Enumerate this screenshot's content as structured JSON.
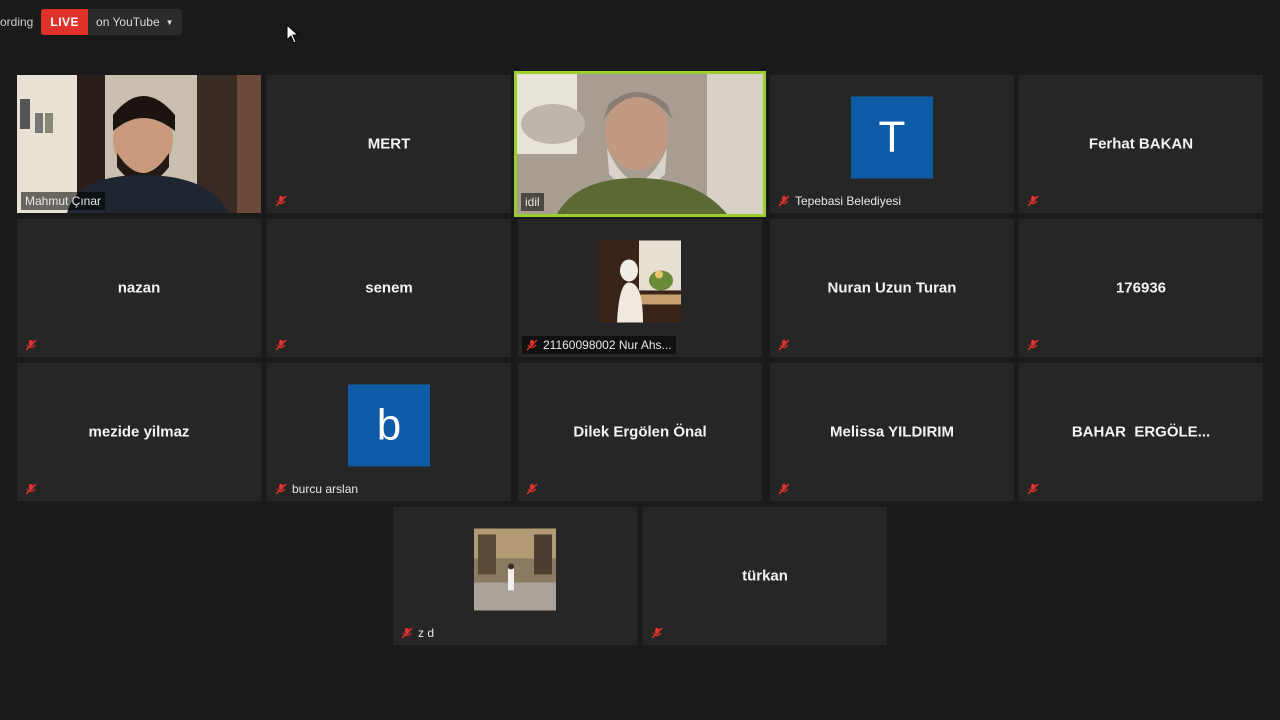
{
  "recording_label": "ording",
  "live": {
    "badge": "LIVE",
    "destination": "on YouTube"
  },
  "tiles": [
    {
      "name": "Mahmut Çınar"
    },
    {
      "name": "MERT"
    },
    {
      "name": "idil"
    },
    {
      "name": "Tepebasi Belediyesi",
      "avatar_letter": "T"
    },
    {
      "name": "Ferhat BAKAN"
    },
    {
      "name": "nazan"
    },
    {
      "name": "senem"
    },
    {
      "name": "21160098002 Nur Ahs..."
    },
    {
      "name": "Nuran Uzun Turan"
    },
    {
      "name": "176936"
    },
    {
      "name": "mezide yilmaz"
    },
    {
      "name": "burcu arslan",
      "avatar_letter": "b"
    },
    {
      "name": "Dilek Ergölen Önal"
    },
    {
      "name": "Melissa YILDIRIM"
    },
    {
      "name": "BAHAR  ERGÖLE..."
    },
    {
      "name": "z d"
    },
    {
      "name": "türkan"
    }
  ],
  "colors": {
    "active_speaker_border": "#9acd32",
    "mute_icon": "#e0312b",
    "live_badge": "#e0312b",
    "avatar_bg": "#0e5ca8"
  }
}
